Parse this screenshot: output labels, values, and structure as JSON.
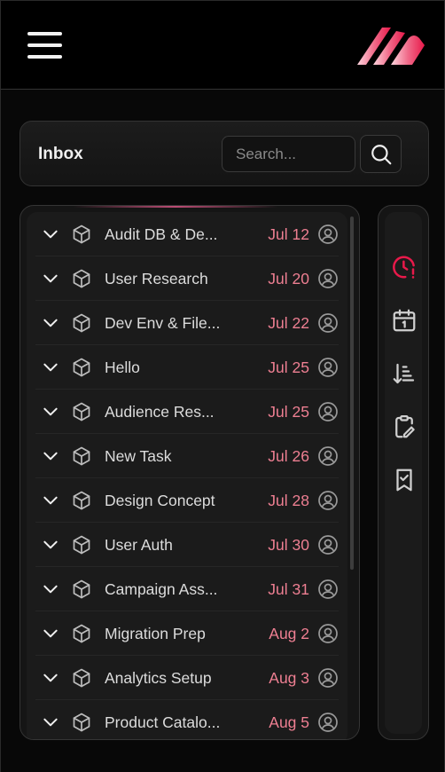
{
  "header": {
    "menu_icon": "hamburger-menu-icon",
    "logo_icon": "brand-logo-stripes"
  },
  "inbox": {
    "title": "Inbox",
    "search_placeholder": "Search...",
    "search_icon": "search-icon"
  },
  "colors": {
    "accent": "#e8194a",
    "date_text": "#ee7f92",
    "background": "#000000"
  },
  "tasks": [
    {
      "name": "Audit DB & De...",
      "date": "Jul 12"
    },
    {
      "name": "User Research",
      "date": "Jul 20"
    },
    {
      "name": "Dev Env & File...",
      "date": "Jul 22"
    },
    {
      "name": "Hello",
      "date": "Jul 25"
    },
    {
      "name": "Audience Res...",
      "date": "Jul 25"
    },
    {
      "name": "New Task",
      "date": "Jul 26"
    },
    {
      "name": "Design Concept",
      "date": "Jul 28"
    },
    {
      "name": "User Auth",
      "date": "Jul 30"
    },
    {
      "name": "Campaign Ass...",
      "date": "Jul 31"
    },
    {
      "name": "Migration Prep",
      "date": "Aug 2"
    },
    {
      "name": "Analytics Setup",
      "date": "Aug 3"
    },
    {
      "name": "Product Catalo...",
      "date": "Aug 5"
    }
  ],
  "sidebar_icons": [
    "clock-alert-icon",
    "calendar-icon",
    "sort-descending-icon",
    "clipboard-edit-icon",
    "bookmark-check-icon"
  ],
  "active_sidebar_icon": "clock-alert-icon"
}
